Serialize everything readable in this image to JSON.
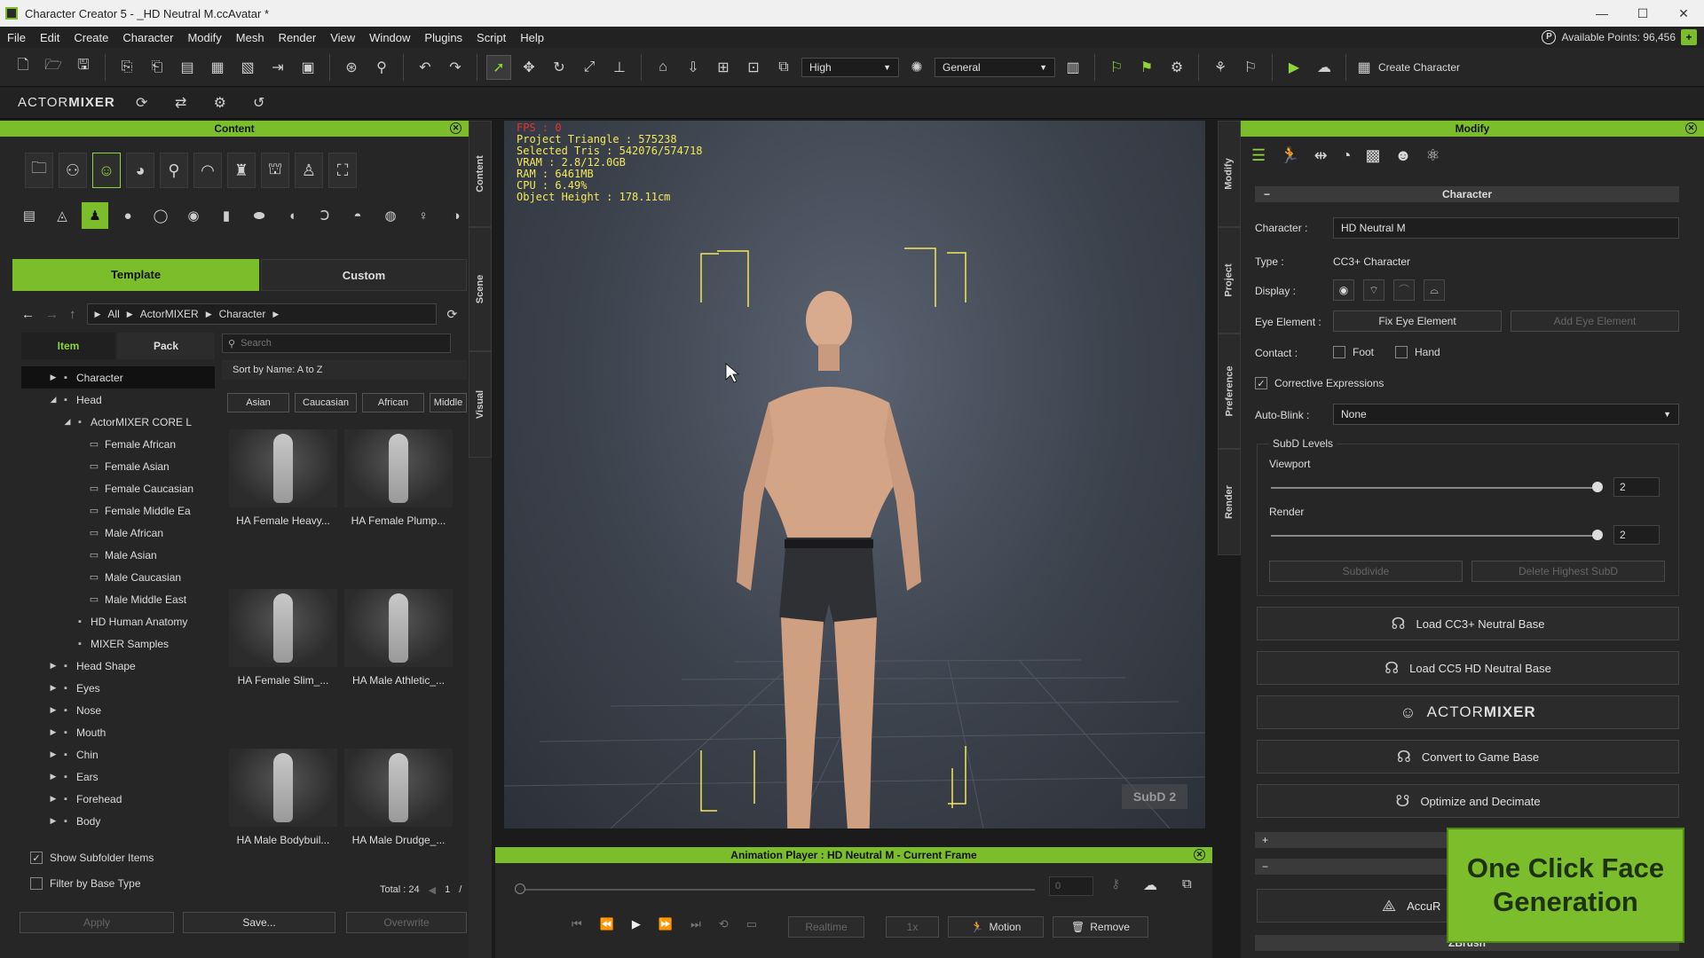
{
  "window": {
    "title": "Character Creator 5 - _HD Neutral M.ccAvatar *",
    "controls": [
      "—",
      "☐",
      "✕"
    ]
  },
  "menu": {
    "items": [
      "File",
      "Edit",
      "Create",
      "Character",
      "Modify",
      "Mesh",
      "Render",
      "View",
      "Window",
      "Plugins",
      "Script",
      "Help"
    ],
    "points_label": "Available Points: 96,456",
    "points_icon": "P",
    "plus": "+"
  },
  "toolbar": {
    "quality": "High",
    "shading": "General",
    "create_character": "Create Character"
  },
  "toolbar2": {
    "logo_prefix": "ACTOR",
    "logo_suffix": "MIXER"
  },
  "content": {
    "header": "Content",
    "side_tabs": [
      "Content",
      "Scene",
      "Visual"
    ],
    "tabs": [
      "Template",
      "Custom"
    ],
    "breadcrumb": [
      "All",
      "ActorMIXER",
      "Character"
    ],
    "subtabs": [
      "Item",
      "Pack"
    ],
    "search_placeholder": "Search",
    "sort": "Sort by Name: A to Z",
    "filters": [
      "Asian",
      "Caucasian",
      "African",
      "Middle"
    ],
    "tree": [
      {
        "label": "Character",
        "level": 1,
        "tri": "▶",
        "sel": true
      },
      {
        "label": "Head",
        "level": 1,
        "tri": "◢"
      },
      {
        "label": "ActorMIXER CORE L",
        "level": 2,
        "tri": "◢"
      },
      {
        "label": "Female African",
        "level": 3,
        "tri": ""
      },
      {
        "label": "Female Asian",
        "level": 3,
        "tri": ""
      },
      {
        "label": "Female Caucasian",
        "level": 3,
        "tri": ""
      },
      {
        "label": "Female Middle Ea",
        "level": 3,
        "tri": ""
      },
      {
        "label": "Male African",
        "level": 3,
        "tri": ""
      },
      {
        "label": "Male Asian",
        "level": 3,
        "tri": ""
      },
      {
        "label": "Male Caucasian",
        "level": 3,
        "tri": ""
      },
      {
        "label": "Male Middle East",
        "level": 3,
        "tri": ""
      },
      {
        "label": "HD Human Anatomy",
        "level": 2,
        "tri": ""
      },
      {
        "label": "MIXER Samples",
        "level": 2,
        "tri": ""
      },
      {
        "label": "Head Shape",
        "level": 1,
        "tri": "▶"
      },
      {
        "label": "Eyes",
        "level": 1,
        "tri": "▶"
      },
      {
        "label": "Nose",
        "level": 1,
        "tri": "▶"
      },
      {
        "label": "Mouth",
        "level": 1,
        "tri": "▶"
      },
      {
        "label": "Chin",
        "level": 1,
        "tri": "▶"
      },
      {
        "label": "Ears",
        "level": 1,
        "tri": "▶"
      },
      {
        "label": "Forehead",
        "level": 1,
        "tri": "▶"
      },
      {
        "label": "Body",
        "level": 1,
        "tri": "▶"
      }
    ],
    "thumbs": [
      "HA Female Heavy...",
      "HA Female Plump...",
      "HA Female Slim_...",
      "HA Male Athletic_...",
      "HA Male Bodybuil...",
      "HA Male Drudge_..."
    ],
    "show_subfolder": "Show Subfolder Items",
    "filter_base": "Filter by Base Type",
    "total": "Total : 24",
    "page": "1",
    "page_sep": "/",
    "buttons": [
      "Apply",
      "Save...",
      "Overwrite"
    ]
  },
  "viewport": {
    "fps": "FPS : 0",
    "stats": [
      "Project Triangle : 575238",
      "Selected Tris : 542076/574718",
      "VRAM : 2.8/12.0GB",
      "RAM : 6461MB",
      "CPU : 6.49%",
      "Object Height : 178.11cm"
    ],
    "subd_badge": "SubD 2"
  },
  "anim": {
    "header": "Animation Player : HD Neutral M - Current Frame",
    "frame": "0",
    "realtime": "Realtime",
    "speed": "1x",
    "motion": "Motion",
    "remove": "Remove"
  },
  "modify": {
    "header": "Modify",
    "side_tabs": [
      "Modify",
      "Project",
      "Preference",
      "Render"
    ],
    "section": "Character",
    "section_toggle": "−",
    "character_label": "Character :",
    "character_value": "HD Neutral M",
    "type_label": "Type :",
    "type_value": "CC3+ Character",
    "display_label": "Display :",
    "eye_label": "Eye Element :",
    "fix_eye": "Fix Eye Element",
    "add_eye": "Add Eye Element",
    "contact_label": "Contact :",
    "foot": "Foot",
    "hand": "Hand",
    "corrective": "Corrective Expressions",
    "autoblink_label": "Auto-Blink :",
    "autoblink_value": "None",
    "subd_title": "SubD Levels",
    "viewport_label": "Viewport",
    "viewport_value": "2",
    "render_label": "Render",
    "render_value": "2",
    "subdivide": "Subdivide",
    "delete_subd": "Delete Highest SubD",
    "big_buttons": [
      "Load CC3+ Neutral Base",
      "Load CC5 HD Neutral Base",
      "",
      "Convert to Game Base",
      "Optimize and Decimate"
    ],
    "accu": "AccuR",
    "zbrush": "ZBrush",
    "expand_plus": "+",
    "collapse_minus": "−"
  },
  "promo": "One Click Face Generation",
  "colors": {
    "accent": "#7cbd2c",
    "stats": "#f3e85a",
    "fps": "#e03434"
  }
}
